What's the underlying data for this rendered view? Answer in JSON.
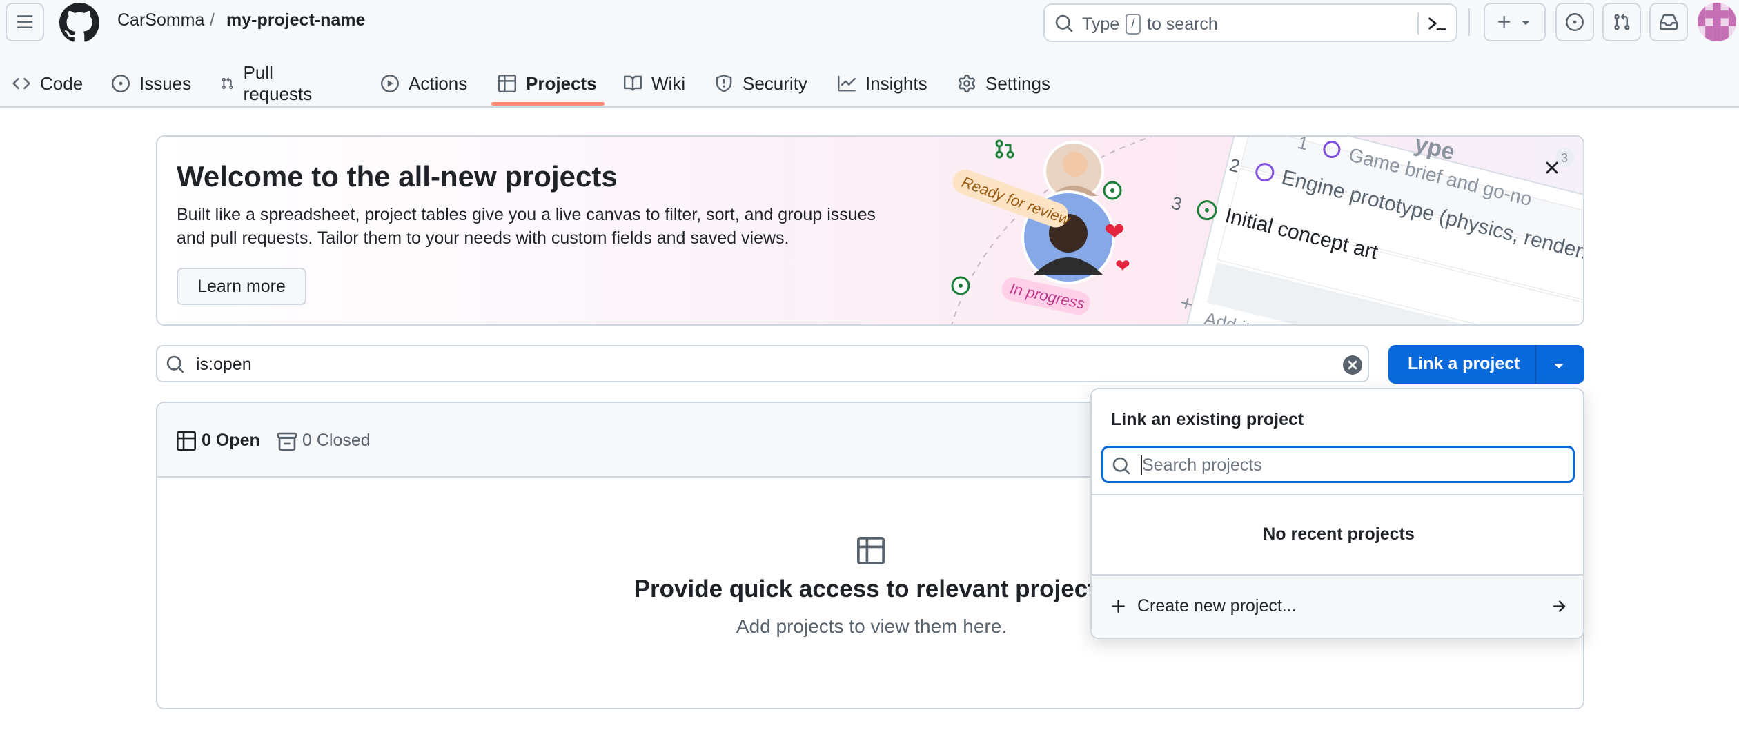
{
  "header": {
    "owner": "CarSomma",
    "separator": "/",
    "repo": "my-project-name",
    "search": {
      "prefix": "Type",
      "key": "/",
      "suffix": "to search"
    }
  },
  "tabs": [
    {
      "label": "Code",
      "icon": "code-icon"
    },
    {
      "label": "Issues",
      "icon": "issue-opened-icon"
    },
    {
      "label": "Pull requests",
      "icon": "git-pull-request-icon"
    },
    {
      "label": "Actions",
      "icon": "play-icon"
    },
    {
      "label": "Projects",
      "icon": "table-icon",
      "active": true
    },
    {
      "label": "Wiki",
      "icon": "book-icon"
    },
    {
      "label": "Security",
      "icon": "shield-icon"
    },
    {
      "label": "Insights",
      "icon": "graph-icon"
    },
    {
      "label": "Settings",
      "icon": "gear-icon"
    }
  ],
  "banner": {
    "title": "Welcome to the all-new projects",
    "text": "Built like a spreadsheet, project tables give you a live canvas to filter, sort, and group issues and pull requests. Tailor them to your needs with custom fields and saved views.",
    "learn_more": "Learn more",
    "art": {
      "ready_for_review": "Ready for review",
      "in_progress": "In progress",
      "rows": [
        {
          "num": "1",
          "text": "Game brief and go-no"
        },
        {
          "num": "2",
          "text": "Engine prototype (physics, renderin"
        },
        {
          "num": "3",
          "text": "Initial concept art"
        }
      ],
      "add_item": "Add ite",
      "type_label": "ype",
      "badge": "3"
    }
  },
  "filter": {
    "value": "is:open"
  },
  "link_button": {
    "label": "Link a project"
  },
  "projects": {
    "open_label": "0 Open",
    "closed_label": "0 Closed",
    "empty_title": "Provide quick access to relevant projects",
    "empty_subtitle": "Add projects to view them here."
  },
  "dropdown": {
    "title": "Link an existing project",
    "search_placeholder": "Search projects",
    "empty_text": "No recent projects",
    "create_label": "Create new project..."
  },
  "colors": {
    "primary": "#0969da",
    "tab_underline": "#fd8c73",
    "border": "#d0d7de"
  }
}
